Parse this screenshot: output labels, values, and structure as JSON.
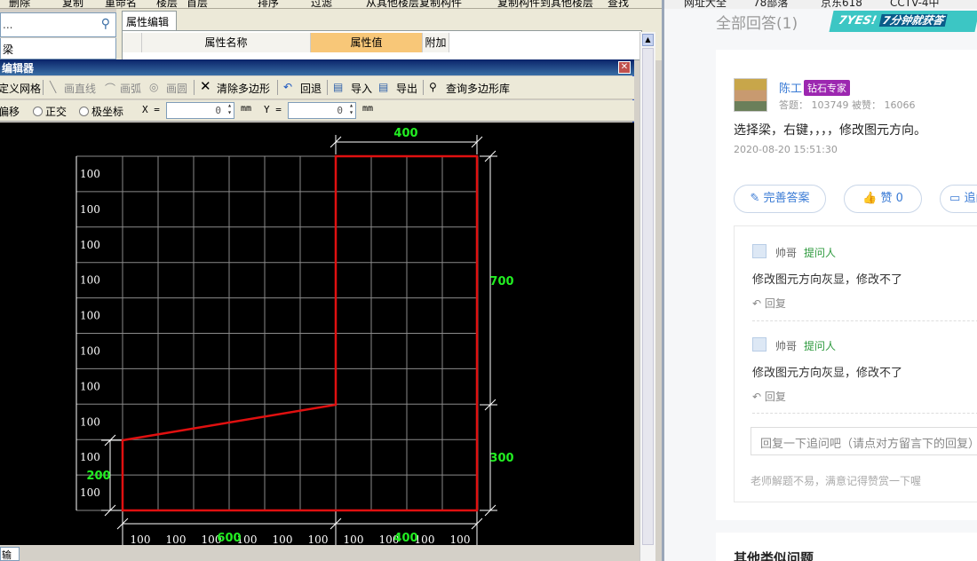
{
  "toolbar_top": {
    "items": [
      "删除",
      "复制",
      "重命名",
      "楼层",
      "首层",
      "排序",
      "过滤",
      "从其他楼层复制构件",
      "复制构件到其他楼层",
      "查找"
    ]
  },
  "search": {
    "value": "...",
    "icon": "search-icon"
  },
  "left_list": {
    "item": "梁"
  },
  "property_panel": {
    "tab": "属性编辑",
    "columns": [
      "属性名称",
      "属性值",
      "附加"
    ],
    "header_value_color": "#f8c778"
  },
  "dialog": {
    "title": "编辑器",
    "toolbar1": {
      "define_grid": "定义网格",
      "draw_line": "画直线",
      "draw_arc": "画弧",
      "draw_circle": "画圆",
      "clear_polygon": "清除多边形",
      "undo": "回退",
      "import": "导入",
      "export": "导出",
      "query_library": "查询多边形库"
    },
    "toolbar2": {
      "offset": "偏移",
      "orthogonal": "正交",
      "polar": "极坐标",
      "x_label": "X =",
      "x_value": "0",
      "x_unit": "mm",
      "y_label": "Y =",
      "y_value": "0",
      "y_unit": "mm"
    },
    "bottom_input": "输入",
    "canvas": {
      "row_labels": [
        "100",
        "100",
        "100",
        "100",
        "100",
        "100",
        "100",
        "100",
        "100",
        "100"
      ],
      "col_labels": [
        "100",
        "100",
        "100",
        "100",
        "100",
        "100",
        "100",
        "100",
        "100",
        "100"
      ],
      "dim_top": "400",
      "dim_right_upper": "700",
      "dim_right_lower": "300",
      "dim_left": "200",
      "dim_bottom_left": "600",
      "dim_bottom_right": "400",
      "shape_color": "#e01010",
      "dim_color": "#22ee22",
      "grid_color": "#8a8a8a"
    }
  },
  "browser_bookmarks": [
    "网址大全",
    "78部落",
    "京东618",
    "CCTV-4中"
  ],
  "qa": {
    "all_answers": "全部回答(1)",
    "banner_text": "7YES!",
    "banner_sub": "7分钟就获答",
    "user": {
      "name": "陈工",
      "badge": "钻石专家",
      "stats": "答题： 103749   被赞： 16066"
    },
    "answer": "选择梁，右键，，，，修改图元方向。",
    "date": "2020-08-20 15:51:30",
    "buttons": {
      "improve": "完善答案",
      "like": "赞 0",
      "follow": "追问"
    },
    "comments": [
      {
        "name": "帅哥",
        "role": "提问人",
        "text": "修改图元方向灰显，修改不了",
        "reply": "回复"
      },
      {
        "name": "帅哥",
        "role": "提问人",
        "text": "修改图元方向灰显，修改不了",
        "reply": "回复"
      }
    ],
    "reply_placeholder": "回复一下追问吧（请点对方留言下的回复）",
    "hint": "老师解题不易，满意记得赞赏一下喔",
    "similar_title": "其他类似问题"
  }
}
